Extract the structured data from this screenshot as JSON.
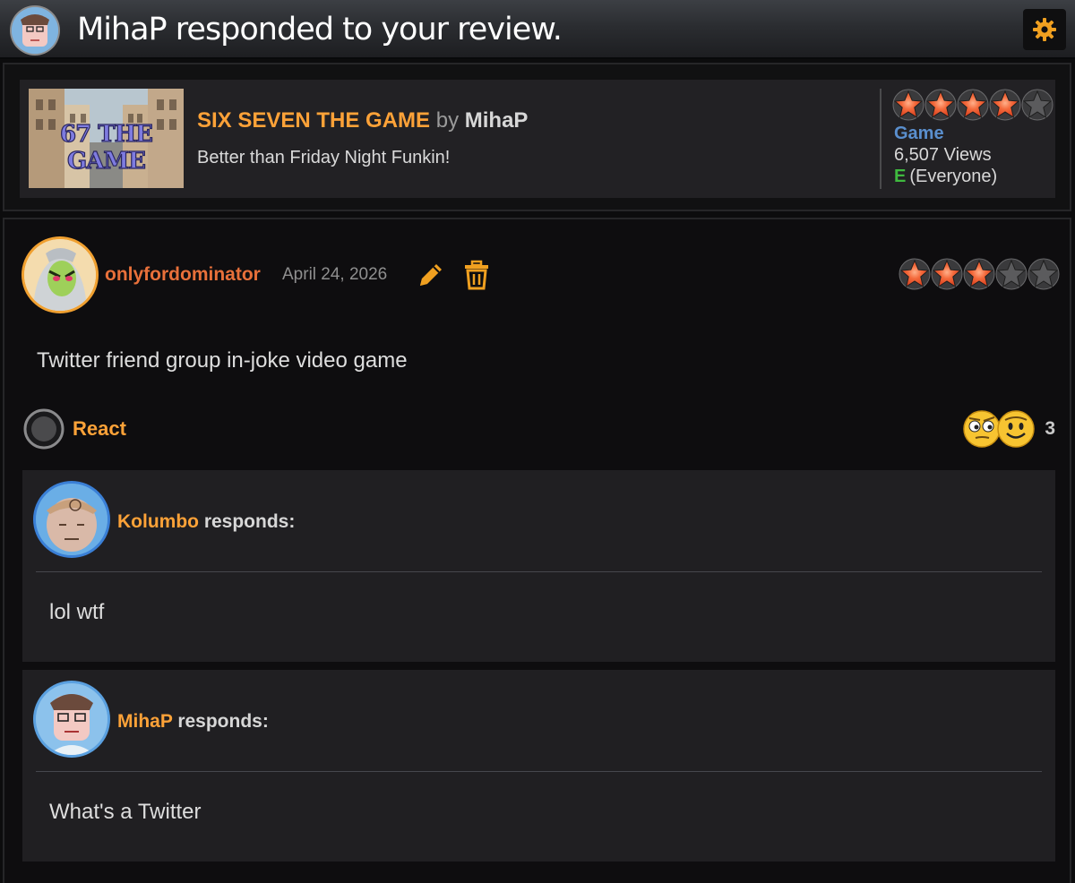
{
  "header": {
    "title": "MihaP responded to your review.",
    "settings_icon": "gear-icon"
  },
  "game": {
    "title": "SIX SEVEN THE GAME",
    "by_word": "by",
    "author": "MihaP",
    "description": "Better than Friday Night Funkin!",
    "thumbnail_text": "67 THE GAME",
    "rating_stars": 4,
    "type": "Game",
    "views": "6,507 Views",
    "rating_letter": "E",
    "rating_label": "(Everyone)"
  },
  "review": {
    "username": "onlyfordominator",
    "date": "April 24, 2026",
    "stars": 3,
    "text": "Twitter friend group in-joke video game",
    "react_label": "React",
    "reaction_count": "3",
    "responses": [
      {
        "name": "Kolumbo",
        "suffix": "responds:",
        "text": "lol wtf"
      },
      {
        "name": "MihaP",
        "suffix": "responds:",
        "text": "What's a Twitter"
      }
    ]
  },
  "colors": {
    "accent_orange": "#fda238",
    "username_orange": "#e8703a",
    "game_type_blue": "#5a8fce",
    "esrb_green": "#3fba3f"
  }
}
